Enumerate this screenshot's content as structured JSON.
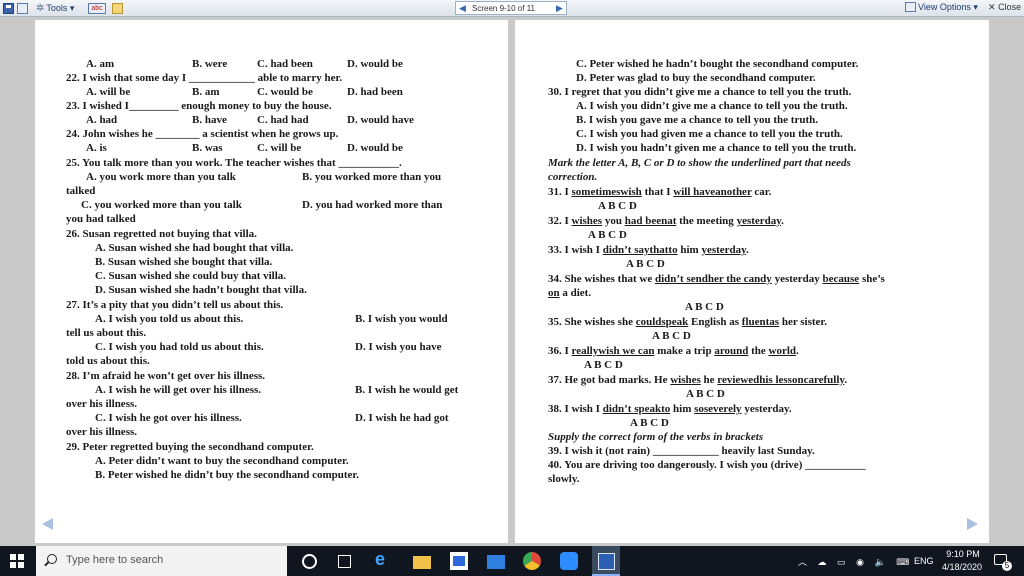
{
  "toolbar": {
    "tools_label": "Tools",
    "screen_label": "Screen 9-10 of 11",
    "view_options_label": "View Options",
    "close_label": "Close"
  },
  "left": {
    "q21_opts": [
      "A. am",
      "B. were",
      "C. had been",
      "D. would be"
    ],
    "q22": "22. I wish that some day I ____________ able to marry her.",
    "q22_opts": [
      "A. will be",
      "B. am",
      "C. would be",
      "D. had been"
    ],
    "q23": "23. I wished I_________ enough money to buy the house.",
    "q23_opts": [
      "A. had",
      "B. have",
      "C. had had",
      "D. would have"
    ],
    "q24": "24. John wishes he ________ a scientist when he grows up.",
    "q24_opts": [
      "A. is",
      "B. was",
      "C. will be",
      "D. would be"
    ],
    "q25": "25. You talk more than you work. The teacher wishes that ___________.",
    "q25_a": "A. you work more than you talk",
    "q25_b": "B. you worked more than you",
    "q25_b2": "talked",
    "q25_c": "C. you worked more than you talk",
    "q25_d": "D. you had worked more than",
    "q25_d2": "you had talked",
    "q26": "26. Susan regretted not buying that villa.",
    "q26_a": "A. Susan wished she had bought that villa.",
    "q26_b": "B. Susan wished she bought that villa.",
    "q26_c": "C. Susan wished she could buy that villa.",
    "q26_d": "D. Susan wished she hadn’t bought that villa.",
    "q27": "27. It’s a pity that you didn’t tell us about this.",
    "q27_a": "A. I wish you told us about this.",
    "q27_b": "B. I wish you would",
    "q27_b2": "tell us about this.",
    "q27_c": "C. I wish you had told us about this.",
    "q27_d": "D. I wish you have",
    "q27_d2": "told us about this.",
    "q28": "28. I’m afraid he won’t get over his illness.",
    "q28_a": "A. I wish he will get over his illness.",
    "q28_b": "B. I wish he would get",
    "q28_b2": "over his illness.",
    "q28_c": "C. I wish he got over his illness.",
    "q28_d": "D. I wish he had got",
    "q28_d2": "over his illness.",
    "q29": "29. Peter regretted buying the secondhand computer.",
    "q29_a": "A. Peter didn’t want to buy the secondhand computer.",
    "q29_b": "B. Peter wished he didn’t buy the secondhand computer."
  },
  "right": {
    "q29_c": "C. Peter wished he hadn’t bought the secondhand computer.",
    "q29_d": "D. Peter was glad to buy the secondhand computer.",
    "q30": "30. I regret that you didn’t give me a chance to tell you the truth.",
    "q30_a": "A. I wish you didn’t give me a chance to tell you the truth.",
    "q30_b": "B. I wish you gave me a chance to tell you the truth.",
    "q30_c": "C. I wish you had given me a chance to tell you the truth.",
    "q30_d": "D. I wish you hadn’t given me a chance to tell you the truth.",
    "instr1": "Mark the letter A, B, C or D to show the underlined part that needs",
    "instr1b": "correction.",
    "q31": [
      "31.  I ",
      "sometimeswish",
      " that I ",
      "will haveanother",
      " car."
    ],
    "q31_letters": "A              B                        C              D",
    "q32": [
      "32.  I ",
      "wishes",
      " you ",
      "had beenat",
      " the meeting ",
      "yesterday",
      "."
    ],
    "q32_letters": "A                  B            C                                D",
    "q33": [
      "33.  I wish I ",
      "didn’t saythatto",
      " him ",
      "yesterday",
      "."
    ],
    "q33_letters": "A            B      C                  D",
    "q34": [
      "34.  She wishes that we ",
      "didn’t sendher the candy",
      " yesterday ",
      "because",
      " she’s"
    ],
    "q34_2": [
      "",
      "on",
      " a diet."
    ],
    "q34_letters": "A                    B                      C                      D",
    "q35": [
      "35.  She wishes she ",
      "couldspeak",
      " English as ",
      "fluentas",
      " her sister."
    ],
    "q35_letters": "A          B                                C    D",
    "q36": [
      "36.  I ",
      "reallywish we can",
      " make a trip ",
      "around",
      " the ",
      "world",
      "."
    ],
    "q36_letters": "A              B                                      C                D",
    "q37": [
      "37.  He got bad marks. He ",
      "wishes",
      " he ",
      "reviewedhis lessoncarefully",
      "."
    ],
    "q37_letters": "A                    B                        C                D",
    "q38": [
      "38.  I wish I ",
      "didn’t speakto",
      " him ",
      "soseverely",
      " yesterday."
    ],
    "q38_letters": "A            B      C     D",
    "instr2": "Supply the correct form of the verbs in brackets",
    "q39": "39. I wish it (not rain) ____________ heavily last Sunday.",
    "q40": "40. You are driving too dangerously.  I wish you (drive) ___________",
    "q40_2": "slowly."
  },
  "taskbar": {
    "search_placeholder": "Type here to search",
    "lang": "ENG",
    "time": "9:10 PM",
    "date": "4/18/2020",
    "notif_count": "5"
  }
}
